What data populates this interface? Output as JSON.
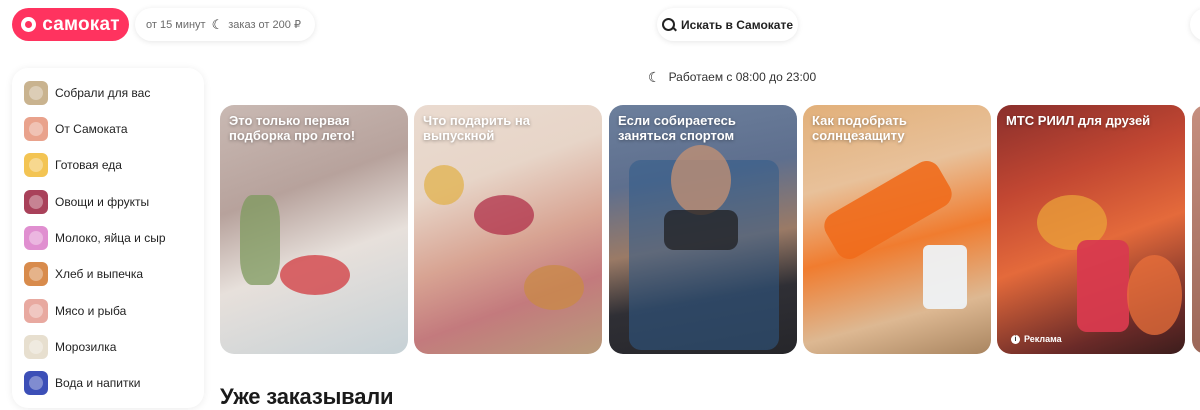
{
  "header": {
    "logo": "самокат",
    "delivery_time": "от 15 минут",
    "delivery_min": "заказ от 200 ₽",
    "search_label": "Искать в Самокате"
  },
  "hours": "Работаем с 08:00 до 23:00",
  "sidebar": {
    "items": [
      {
        "label": "Собрали для вас",
        "color": "#c9b38f"
      },
      {
        "label": "От Самоката",
        "color": "#e9a28c"
      },
      {
        "label": "Готовая еда",
        "color": "#f3c453"
      },
      {
        "label": "Овощи и фрукты",
        "color": "#a9415a"
      },
      {
        "label": "Молоко, яйца и сыр",
        "color": "#e08fd0"
      },
      {
        "label": "Хлеб и выпечка",
        "color": "#d88b4c"
      },
      {
        "label": "Мясо и рыба",
        "color": "#e8a9a0"
      },
      {
        "label": "Морозилка",
        "color": "#e7dfcf"
      },
      {
        "label": "Вода и напитки",
        "color": "#3c4fb7"
      }
    ]
  },
  "stories": [
    {
      "title": "Это только первая подборка про лето!"
    },
    {
      "title": "Что подарить на выпускной"
    },
    {
      "title": "Если собираетесь заняться спортом"
    },
    {
      "title": "Как подобрать солнцезащиту"
    },
    {
      "title": "МТС РИИЛ для друзей",
      "badge": "Реклама"
    }
  ],
  "section_title": "Уже заказывали"
}
